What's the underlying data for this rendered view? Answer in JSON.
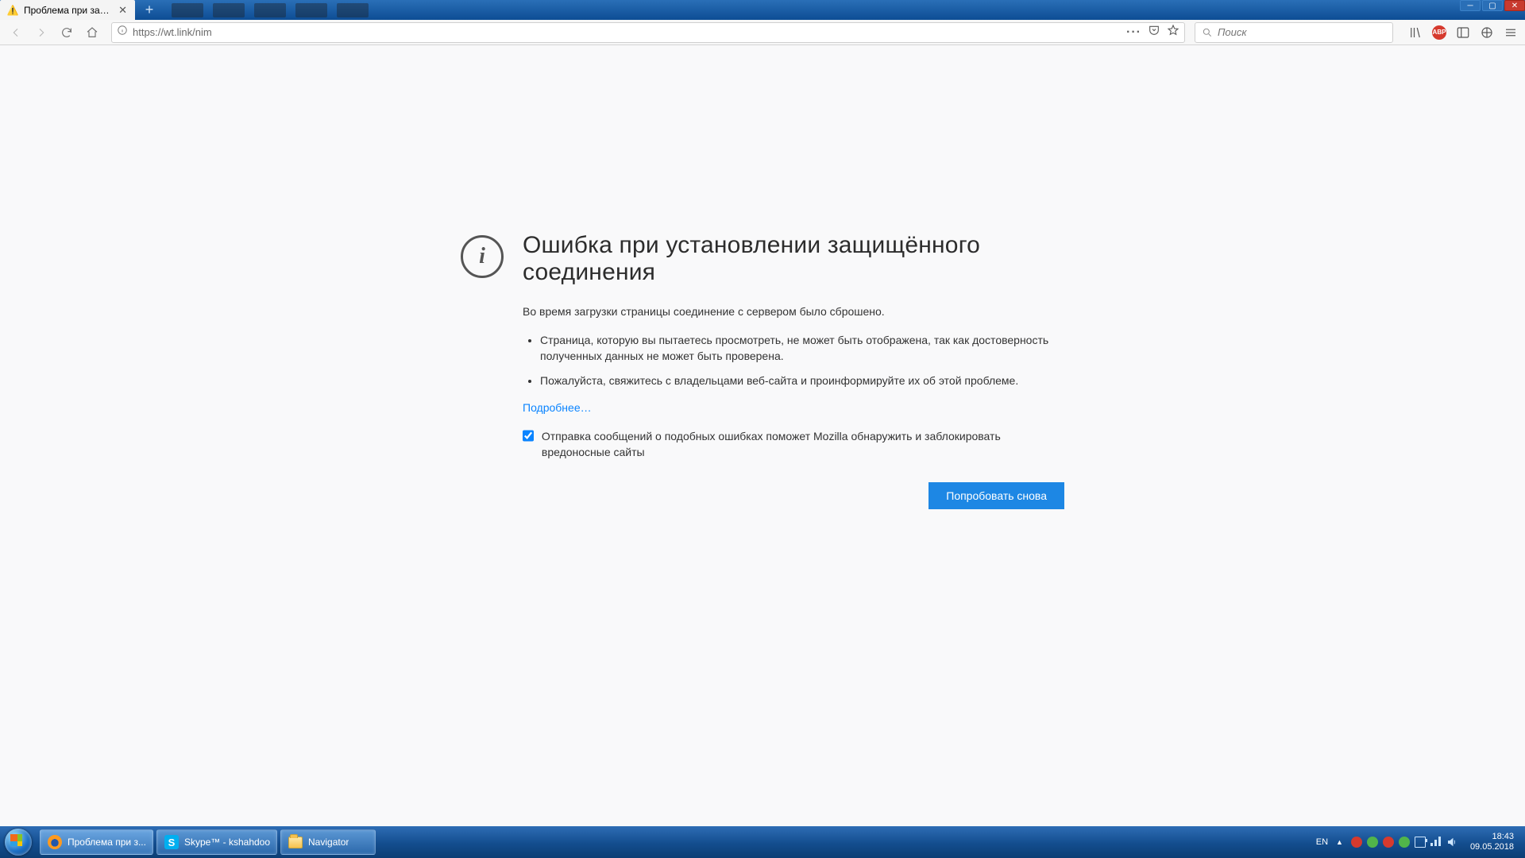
{
  "window": {
    "tab_title": "Проблема при загрузке стра"
  },
  "toolbar": {
    "url": "https://wt.link/nim",
    "search_placeholder": "Поиск"
  },
  "error": {
    "title": "Ошибка при установлении защищённого соединения",
    "lead": "Во время загрузки страницы соединение с сервером было сброшено.",
    "bullets": [
      "Страница, которую вы пытаетесь просмотреть, не может быть отображена, так как достоверность полученных данных не может быть проверена.",
      "Пожалуйста, свяжитесь с владельцами веб-сайта и проинформируйте их об этой проблеме."
    ],
    "learn_more": "Подробнее…",
    "report_label": "Отправка сообщений о подобных ошибках поможет Mozilla обнаружить и заблокировать вредоносные сайты",
    "retry": "Попробовать снова"
  },
  "taskbar": {
    "items": [
      {
        "label": "Проблема при з..."
      },
      {
        "label": "Skype™ - kshahdoo"
      },
      {
        "label": "Navigator"
      }
    ],
    "lang": "EN",
    "time": "18:43",
    "date": "09.05.2018"
  }
}
